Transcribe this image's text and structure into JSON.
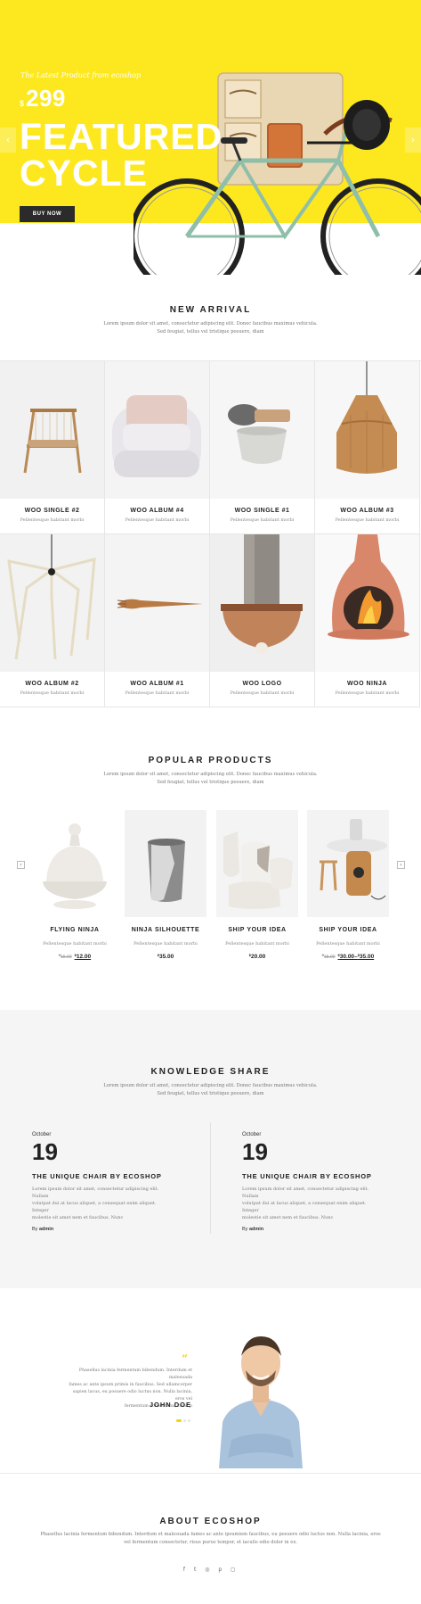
{
  "hero": {
    "kicker": "The Latest Product from ecoshop",
    "currency": "$",
    "price": "299",
    "title_line1": "FEATURED",
    "title_line2": "CYCLE",
    "button": "BUY NOW",
    "prev_arrow": "‹",
    "next_arrow": "›",
    "colors": {
      "accent": "#fde81f",
      "button": "#2b2b2b"
    }
  },
  "new_arrival": {
    "title": "NEW ARRIVAL",
    "text_line1": "Lorem ipsum dolor sit amet, consectetur adipiscing elit. Donec faucibus maximus vehicula.",
    "text_line2": "Sed feugiat, tellus vel tristique posuere, diam",
    "items": [
      {
        "name": "WOO SINGLE #2",
        "sub": "Pellentesque habitant morbi",
        "image": "wooden-chair"
      },
      {
        "name": "WOO ALBUM #4",
        "sub": "Pellentesque habitant morbi",
        "image": "armchair"
      },
      {
        "name": "WOO SINGLE #1",
        "sub": "Pellentesque habitant morbi",
        "image": "shaving-brush-bowl"
      },
      {
        "name": "WOO ALBUM #3",
        "sub": "Pellentesque habitant morbi",
        "image": "wooden-pendant-lamp"
      },
      {
        "name": "WOO ALBUM #2",
        "sub": "Pellentesque habitant morbi",
        "image": "spider-chandelier"
      },
      {
        "name": "WOO ALBUM #1",
        "sub": "Pellentesque habitant morbi",
        "image": "wooden-fork"
      },
      {
        "name": "WOO LOGO",
        "sub": "Pellentesque habitant morbi",
        "image": "copper-pendant-lamp"
      },
      {
        "name": "WOO NINJA",
        "sub": "Pellentesque habitant morbi",
        "image": "terracotta-fireplace"
      }
    ]
  },
  "popular": {
    "title": "POPULAR PRODUCTS",
    "text_line1": "Lorem ipsum dolor sit amet, consectetur adipiscing elit. Donec faucibus maximus vehicula.",
    "text_line2": "Sed feugiat, tellus vel tristique posuere, diam",
    "prev_arrow": "‹",
    "next_arrow": "›",
    "items": [
      {
        "name": "FLYING NINJA",
        "sub": "Pellentesque habitant morbi",
        "old_price": "15.00",
        "price": "12.00",
        "image": "white-ceramic-dome"
      },
      {
        "name": "NINJA SILHOUETTE",
        "sub": "Pellentesque habitant morbi",
        "old_price": "",
        "price": "35.00",
        "image": "grey-ceramic-cup"
      },
      {
        "name": "SHIP YOUR IDEA",
        "sub": "Pellentesque habitant morbi",
        "old_price": "",
        "price": "20.00",
        "image": "white-ceramic-sculptures"
      },
      {
        "name": "SHIP YOUR IDEA",
        "sub": "Pellentesque habitant morbi",
        "old_price": "15.00",
        "price": "30.00",
        "price_to": "35.00",
        "image": "round-table-lamp"
      }
    ],
    "currency": "$"
  },
  "knowledge": {
    "title": "KNOWLEDGE SHARE",
    "text_line1": "Lorem ipsum dolor sit amet, consectetur adipiscing elit. Donec faucibus maximus vehicula.",
    "text_line2": "Sed feugiat, tellus vel tristique posuere, diam",
    "posts": [
      {
        "month": "October",
        "day": "19",
        "title": "THE UNIQUE CHAIR BY ECOSHOP",
        "text_line1": "Lorem ipsum dolor sit amet, consectetur adipiscing elit. Nullam",
        "text_line2": "volutpat dui at lacus aliquet, a consequat enim aliquet. Integer",
        "text_line3": "molestie sit amet nem et faucibus. Nunc",
        "by_label": "By",
        "author": "admin"
      },
      {
        "month": "October",
        "day": "19",
        "title": "THE UNIQUE CHAIR BY ECOSHOP",
        "text_line1": "Lorem ipsum dolor sit amet, consectetur adipiscing elit. Nullam",
        "text_line2": "volutpat dui at lacus aliquet, a consequat enim aliquet. Integer",
        "text_line3": "molestie sit amet nem et faucibus. Nunc",
        "by_label": "By",
        "author": "admin"
      }
    ]
  },
  "testimonial": {
    "quote_mark": "“",
    "line1": "Phasellus lacinia fermentum bibendum. Interdum et malesuada",
    "line2": "fames ac ante ipsum primis in faucibus. Sed ullamcorper",
    "line3": "sapien lacus, eu posuere odio luctus non. Nulla lacinia, eros vel",
    "line4": "fermentum consectetur, risus p",
    "name": "JOHN DOE"
  },
  "about": {
    "title": "ABOUT ECOSHOP",
    "text_line1": "Phasellus lacinia fermentum bibendum. Interdum et malesuada fames ac ante ipsumiem faucibus, eu posuere odio luctus non. Nulla lacinia, eros",
    "text_line2": "vel fermentum consectetur, risus purus tempor, et iaculis odio dolor in ex.",
    "social": [
      {
        "label": "f",
        "icon": "facebook-icon"
      },
      {
        "label": "t",
        "icon": "twitter-icon"
      },
      {
        "label": "◎",
        "icon": "dribbble-icon"
      },
      {
        "label": "p",
        "icon": "pinterest-icon"
      },
      {
        "label": "◻",
        "icon": "instagram-icon"
      }
    ]
  }
}
